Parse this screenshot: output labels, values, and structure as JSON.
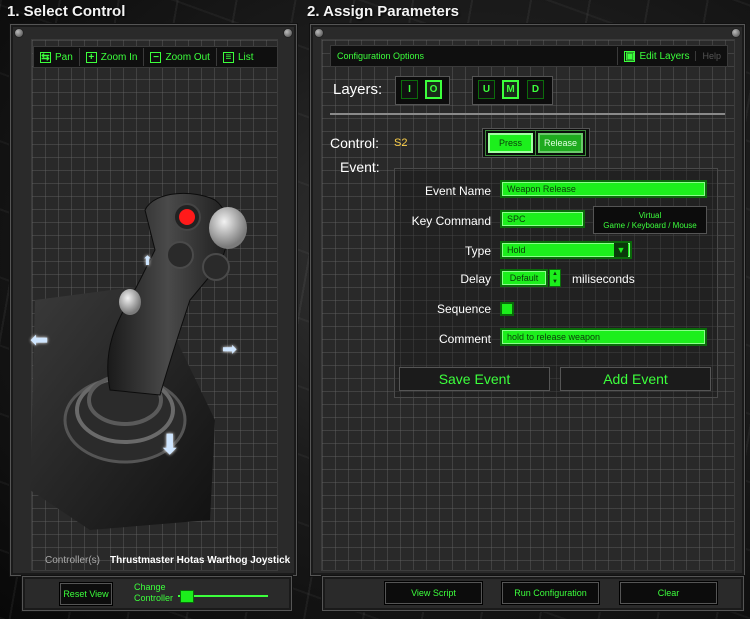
{
  "sections": {
    "select_title": "1. Select Control",
    "assign_title": "2. Assign Parameters"
  },
  "left_toolbar": {
    "pan": "Pan",
    "zoom_in": "Zoom In",
    "zoom_out": "Zoom Out",
    "list": "List"
  },
  "controller": {
    "label": "Controller(s)",
    "name": "Thrustmaster Hotas Warthog Joystick"
  },
  "left_footer": {
    "reset_view": "Reset View",
    "change_controller_line1": "Change",
    "change_controller_line2": "Controller"
  },
  "config": {
    "title": "Configuration Options",
    "edit_layers": "Edit Layers",
    "help": "Help"
  },
  "layers": {
    "label": "Layers:",
    "group1": [
      "I",
      "O"
    ],
    "group2": [
      "U",
      "M",
      "D"
    ]
  },
  "control": {
    "label": "Control:",
    "value": "S2",
    "press": "Press",
    "release": "Release"
  },
  "event": {
    "label": "Event:",
    "name_label": "Event Name",
    "name_value": "Weapon Release",
    "key_label": "Key Command",
    "key_value": "SPC",
    "virtual_line1": "Virtual",
    "virtual_line2": "Game / Keyboard / Mouse",
    "type_label": "Type",
    "type_value": "Hold",
    "delay_label": "Delay",
    "delay_value": "Default",
    "delay_unit": "miliseconds",
    "sequence_label": "Sequence",
    "comment_label": "Comment",
    "comment_value": "hold to release weapon",
    "save": "Save Event",
    "add": "Add Event"
  },
  "right_footer": {
    "view_script": "View Script",
    "run_config": "Run Configuration",
    "clear": "Clear"
  },
  "colors": {
    "accent": "#3cff3c",
    "field": "#1cef1c",
    "control_value": "#ffd24a",
    "joystick_button": "#ff1a1a"
  }
}
